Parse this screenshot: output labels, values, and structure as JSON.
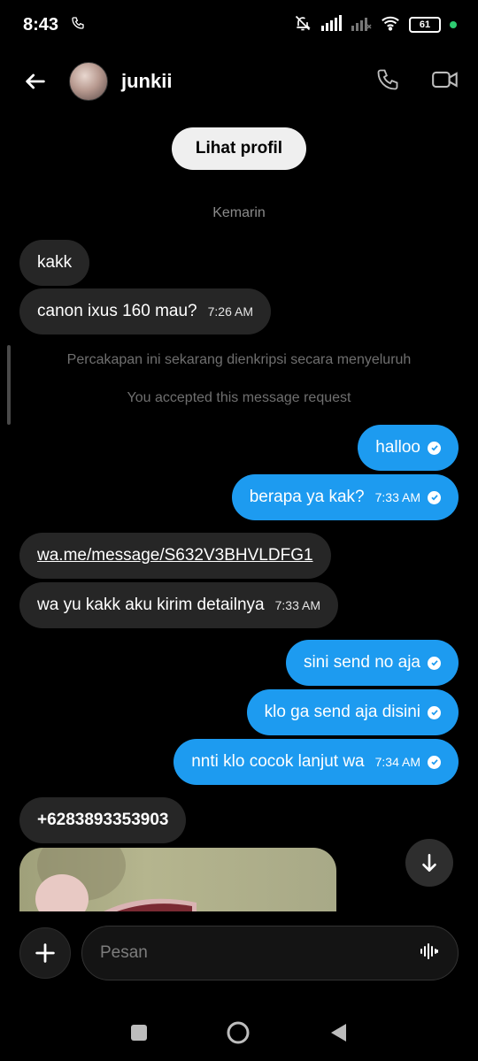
{
  "status": {
    "time": "8:43",
    "battery": "61"
  },
  "header": {
    "username": "junkii"
  },
  "profile_button": "Lihat profil",
  "date_label": "Kemarin",
  "messages": [
    {
      "text": "kakk",
      "time": "",
      "from": "in"
    },
    {
      "text": "canon ixus 160 mau?",
      "time": "7:26 AM",
      "from": "in"
    },
    {
      "text": "halloo",
      "time": "",
      "from": "out"
    },
    {
      "text": "berapa ya kak?",
      "time": "7:33 AM",
      "from": "out"
    },
    {
      "text": "wa.me/message/S632V3BHVLDFG1",
      "time": "",
      "from": "in"
    },
    {
      "text": "wa yu kakk aku kirim detailnya",
      "time": "7:33 AM",
      "from": "in"
    },
    {
      "text": "sini send no aja",
      "time": "",
      "from": "out"
    },
    {
      "text": "klo ga send aja disini",
      "time": "",
      "from": "out"
    },
    {
      "text": "nnti klo cocok lanjut wa",
      "time": "7:34 AM",
      "from": "out"
    },
    {
      "text": "+6283893353903",
      "time": "",
      "from": "in"
    }
  ],
  "system_messages": {
    "encrypted": "Percakapan ini sekarang dienkripsi secara menyeluruh",
    "accepted": "You accepted this message request"
  },
  "composer": {
    "placeholder": "Pesan"
  },
  "colors": {
    "accent": "#1d9bf0",
    "incoming_bubble": "#262626",
    "background": "#000000"
  }
}
